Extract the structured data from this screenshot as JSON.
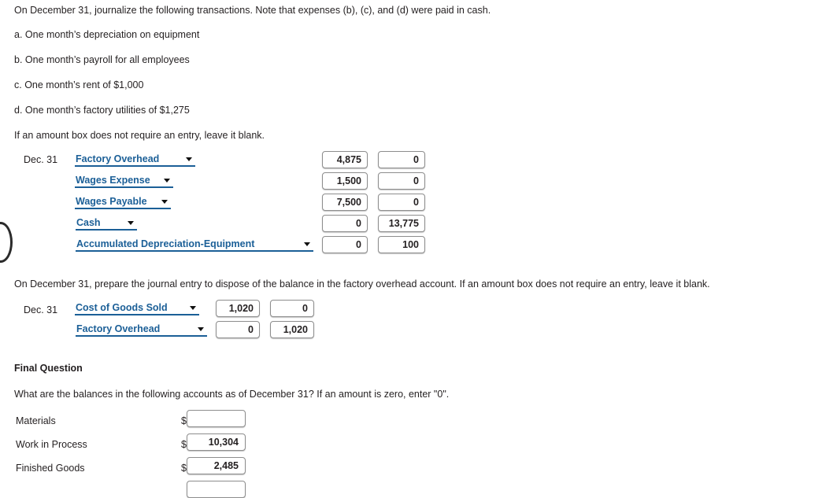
{
  "colors": {
    "accent_blue": "#1b5f97",
    "text": "#231f20",
    "box_border": "#8d8d8d",
    "page_background": "#ffffff"
  },
  "instructions": {
    "intro": "On December 31, journalize the following transactions. Note that expenses (b), (c), and (d) were paid in cash.",
    "items": [
      "a. One month’s depreciation on equipment",
      "b. One month’s payroll for all employees",
      "c. One month’s rent of $1,000",
      "d. One month’s factory utilities of $1,275"
    ],
    "blank_note": "If an amount box does not require an entry, leave it blank."
  },
  "journal_entry_1": {
    "date": "Dec. 31",
    "rows": [
      {
        "account": "Factory Overhead",
        "debit": "4,875",
        "credit": "0",
        "indented": false,
        "select_width": 163
      },
      {
        "account": "Wages Expense",
        "debit": "1,500",
        "credit": "0",
        "indented": false,
        "select_width": 147
      },
      {
        "account": "Wages Payable",
        "debit": "7,500",
        "credit": "0",
        "indented": false,
        "select_width": 145
      },
      {
        "account": "Cash",
        "debit": "0",
        "credit": "13,775",
        "indented": true,
        "select_width": 79
      },
      {
        "account": "Accumulated Depreciation-Equipment",
        "debit": "0",
        "credit": "100",
        "indented": true,
        "select_width": 303
      }
    ]
  },
  "journal_entry_2": {
    "prompt": "On December 31, prepare the journal entry to dispose of the balance in the factory overhead account. If an amount box does not require an entry, leave it blank.",
    "date": "Dec. 31",
    "rows": [
      {
        "account": "Cost of Goods Sold",
        "debit": "1,020",
        "credit": "0",
        "indented": false,
        "select_width": 168
      },
      {
        "account": "Factory Overhead",
        "debit": "0",
        "credit": "1,020",
        "indented": true,
        "select_width": 168
      }
    ]
  },
  "final_question": {
    "heading": "Final Question",
    "prompt": "What are the balances in the following accounts as of December 31? If an amount is zero, enter \"0\".",
    "currency_symbol": "$",
    "rows": [
      {
        "label": "Materials",
        "value": "",
        "placeholder": ""
      },
      {
        "label": "Work in Process",
        "value": "10,304",
        "placeholder": ""
      },
      {
        "label": "Finished Goods",
        "value": "2,485",
        "placeholder": ""
      },
      {
        "label": "",
        "value": "",
        "placeholder": ""
      }
    ]
  },
  "icons": {
    "dropdown_caret": "chevron-down-icon"
  }
}
